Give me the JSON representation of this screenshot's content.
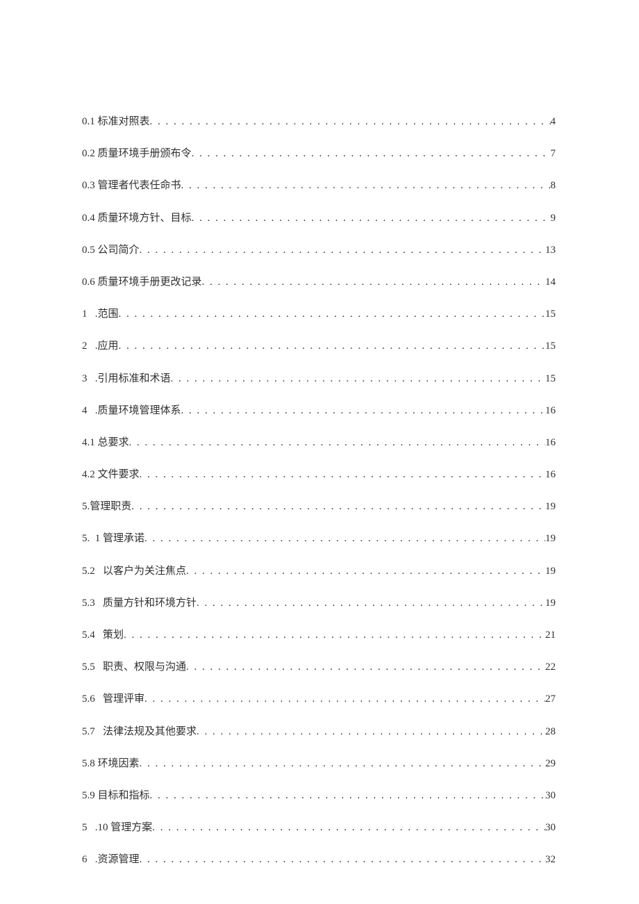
{
  "toc": [
    {
      "num": "0.1",
      "gap": " ",
      "title": "标准对照表",
      "page": "4"
    },
    {
      "num": "0.2",
      "gap": " ",
      "title": "质量环境手册颁布令",
      "page": "7"
    },
    {
      "num": "0.3",
      "gap": " ",
      "title": "管理者代表任命书",
      "page": "8"
    },
    {
      "num": "0.4",
      "gap": " ",
      "title": "质量环境方针、目标",
      "page": "9"
    },
    {
      "num": "0.5",
      "gap": " ",
      "title": "公司简介",
      "page": "13"
    },
    {
      "num": "0.6",
      "gap": " ",
      "title": "质量环境手册更改记录",
      "page": "14"
    },
    {
      "num": "1",
      "gap": "   .",
      "title": "范围",
      "page": "15"
    },
    {
      "num": "2",
      "gap": "   .",
      "title": "应用",
      "page": "15"
    },
    {
      "num": "3",
      "gap": "   .",
      "title": "引用标准和术语",
      "page": "15"
    },
    {
      "num": "4",
      "gap": "   .",
      "title": "质量环境管理体系",
      "page": "16"
    },
    {
      "num": "4.1",
      "gap": " ",
      "title": "总要求",
      "page": "16"
    },
    {
      "num": "4.2",
      "gap": " ",
      "title": "文件要求",
      "page": "16"
    },
    {
      "num": "5.",
      "gap": "",
      "title": "管理职责",
      "page": "19"
    },
    {
      "num": "5.",
      "gap": "  1 ",
      "title": "管理承诺",
      "page": "19"
    },
    {
      "num": "5.2",
      "gap": "   ",
      "title": "以客户为关注焦点",
      "page": "19"
    },
    {
      "num": "5.3",
      "gap": "   ",
      "title": "质量方针和环境方针",
      "page": "19"
    },
    {
      "num": "5.4",
      "gap": "   ",
      "title": "策划",
      "page": "21"
    },
    {
      "num": "5.5",
      "gap": "   ",
      "title": "职责、权限与沟通",
      "page": "22"
    },
    {
      "num": "5.6",
      "gap": "   ",
      "title": "管理评审",
      "page": "27"
    },
    {
      "num": "5.7",
      "gap": "   ",
      "title": "法律法规及其他要求",
      "page": "28"
    },
    {
      "num": "5.8",
      "gap": " ",
      "title": "环境因素",
      "page": "29"
    },
    {
      "num": "5.9",
      "gap": " ",
      "title": "目标和指标",
      "page": "30"
    },
    {
      "num": "5",
      "gap": "   .10 ",
      "title": "管理方案",
      "page": "30"
    },
    {
      "num": "6",
      "gap": "   .",
      "title": "资源管理",
      "page": "32"
    }
  ]
}
